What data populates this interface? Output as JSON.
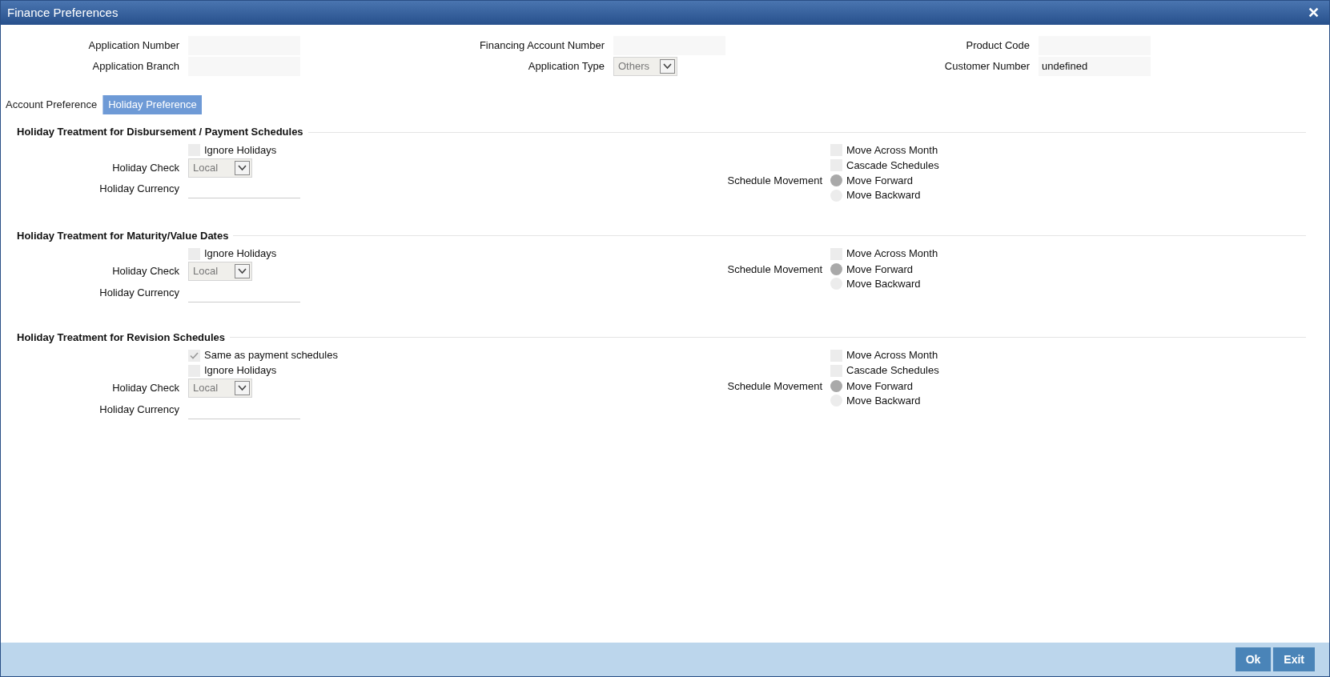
{
  "window": {
    "title": "Finance Preferences",
    "close": "✕"
  },
  "header_fields": [
    {
      "label": "Application Number",
      "kind": "text"
    },
    {
      "label": "Financing Account Number",
      "kind": "text"
    },
    {
      "label": "Product Code",
      "kind": "text"
    },
    {
      "label": "Application Branch",
      "kind": "text"
    },
    {
      "label": "Application Type",
      "kind": "select",
      "value": "Others"
    },
    {
      "label": "Customer Number",
      "kind": "text",
      "value": "undefined"
    }
  ],
  "tabs": [
    {
      "label": "Account Preference",
      "selected": false
    },
    {
      "label": "Holiday Preference",
      "selected": true
    }
  ],
  "sections": [
    {
      "title": "Holiday Treatment for Disbursement / Payment Schedules",
      "left": [
        {
          "kind": "checkbox",
          "label": "Ignore Holidays",
          "checked": false
        },
        {
          "kind": "select",
          "label": "Holiday Check",
          "value": "Local"
        },
        {
          "kind": "text",
          "label": "Holiday Currency"
        }
      ],
      "right_label": "Schedule Movement",
      "right": [
        {
          "kind": "checkbox",
          "label": "Move Across Month",
          "checked": false
        },
        {
          "kind": "checkbox",
          "label": "Cascade Schedules",
          "checked": false
        },
        {
          "kind": "radio",
          "label": "Move Forward",
          "selected": true
        },
        {
          "kind": "radio",
          "label": "Move Backward",
          "selected": false
        }
      ]
    },
    {
      "title": "Holiday Treatment for Maturity/Value Dates",
      "left": [
        {
          "kind": "checkbox",
          "label": "Ignore Holidays",
          "checked": false
        },
        {
          "kind": "select",
          "label": "Holiday Check",
          "value": "Local"
        },
        {
          "kind": "text",
          "label": "Holiday Currency"
        }
      ],
      "right_label": "Schedule Movement",
      "right": [
        {
          "kind": "checkbox",
          "label": "Move Across Month",
          "checked": false
        },
        {
          "kind": "radio",
          "label": "Move Forward",
          "selected": true
        },
        {
          "kind": "radio",
          "label": "Move Backward",
          "selected": false
        }
      ]
    },
    {
      "title": "Holiday Treatment for Revision Schedules",
      "left": [
        {
          "kind": "checkbox",
          "label": "Same as payment schedules",
          "checked": true
        },
        {
          "kind": "checkbox",
          "label": "Ignore Holidays",
          "checked": false
        },
        {
          "kind": "select",
          "label": "Holiday Check",
          "value": "Local"
        },
        {
          "kind": "text",
          "label": "Holiday Currency"
        }
      ],
      "right_label": "Schedule Movement",
      "right": [
        {
          "kind": "checkbox",
          "label": "Move Across Month",
          "checked": false
        },
        {
          "kind": "checkbox",
          "label": "Cascade Schedules",
          "checked": false
        },
        {
          "kind": "radio",
          "label": "Move Forward",
          "selected": true
        },
        {
          "kind": "radio",
          "label": "Move Backward",
          "selected": false
        }
      ]
    }
  ],
  "buttons": [
    "Ok",
    "Exit"
  ]
}
